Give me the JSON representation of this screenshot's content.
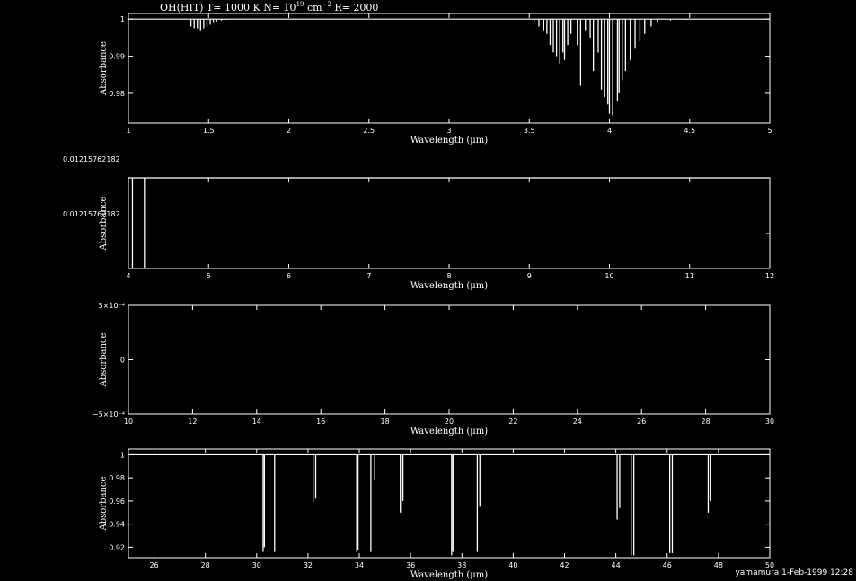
{
  "title": "OH(HIT) T= 1000 K N= 10^19 cm^-2 R= 2000",
  "footer": "yamamura 1-Feb-1999 12:28",
  "colors": {
    "background": "#000000",
    "foreground": "#ffffff"
  },
  "chart_data": [
    {
      "type": "line",
      "xlabel": "Wavelength (μm)",
      "ylabel": "Absorbance",
      "xlim": [
        1,
        5
      ],
      "ylim": [
        0.972,
        1.0015
      ],
      "baseline": 1.0,
      "xticks": [
        1,
        1.5,
        2,
        2.5,
        3,
        3.5,
        4,
        4.5,
        5
      ],
      "xtick_labels": [
        "1",
        "1.5",
        "2",
        "2.5",
        "3",
        "3.5",
        "4",
        "4.5",
        "5"
      ],
      "yticks": [
        1.0,
        0.99,
        0.98
      ],
      "ytick_labels": [
        "1",
        "0.99",
        "0.98"
      ],
      "lines": [
        {
          "x": 1.39,
          "y": 0.998
        },
        {
          "x": 1.41,
          "y": 0.9975
        },
        {
          "x": 1.43,
          "y": 0.9975
        },
        {
          "x": 1.45,
          "y": 0.997
        },
        {
          "x": 1.47,
          "y": 0.9975
        },
        {
          "x": 1.49,
          "y": 0.998
        },
        {
          "x": 1.51,
          "y": 0.9985
        },
        {
          "x": 1.53,
          "y": 0.999
        },
        {
          "x": 1.55,
          "y": 0.9993
        },
        {
          "x": 1.58,
          "y": 0.9996
        },
        {
          "x": 1.61,
          "y": 0.9998
        },
        {
          "x": 1.65,
          "y": 0.9999
        },
        {
          "x": 3.53,
          "y": 0.999
        },
        {
          "x": 3.56,
          "y": 0.998
        },
        {
          "x": 3.59,
          "y": 0.997
        },
        {
          "x": 3.61,
          "y": 0.996
        },
        {
          "x": 3.63,
          "y": 0.993
        },
        {
          "x": 3.65,
          "y": 0.991
        },
        {
          "x": 3.67,
          "y": 0.99
        },
        {
          "x": 3.69,
          "y": 0.988
        },
        {
          "x": 3.71,
          "y": 0.991
        },
        {
          "x": 3.72,
          "y": 0.989
        },
        {
          "x": 3.74,
          "y": 0.993
        },
        {
          "x": 3.76,
          "y": 0.996
        },
        {
          "x": 3.8,
          "y": 0.993
        },
        {
          "x": 3.82,
          "y": 0.982
        },
        {
          "x": 3.85,
          "y": 0.997
        },
        {
          "x": 3.88,
          "y": 0.995
        },
        {
          "x": 3.9,
          "y": 0.986
        },
        {
          "x": 3.93,
          "y": 0.991
        },
        {
          "x": 3.95,
          "y": 0.981
        },
        {
          "x": 3.97,
          "y": 0.979
        },
        {
          "x": 3.99,
          "y": 0.977
        },
        {
          "x": 4.0,
          "y": 0.9745
        },
        {
          "x": 4.02,
          "y": 0.974
        },
        {
          "x": 4.05,
          "y": 0.978
        },
        {
          "x": 4.06,
          "y": 0.98
        },
        {
          "x": 4.08,
          "y": 0.9835
        },
        {
          "x": 4.1,
          "y": 0.986
        },
        {
          "x": 4.13,
          "y": 0.989
        },
        {
          "x": 4.16,
          "y": 0.992
        },
        {
          "x": 4.19,
          "y": 0.994
        },
        {
          "x": 4.22,
          "y": 0.996
        },
        {
          "x": 4.26,
          "y": 0.998
        },
        {
          "x": 4.3,
          "y": 0.999
        },
        {
          "x": 4.38,
          "y": 0.9996
        },
        {
          "x": 4.48,
          "y": 0.9998
        }
      ]
    },
    {
      "type": "line",
      "xlabel": "Wavelength (μm)",
      "ylabel": "Absorbance",
      "xlim": [
        4,
        12
      ],
      "ylim": [
        0,
        1
      ],
      "baseline": 1.0,
      "xticks": [
        4,
        5,
        6,
        7,
        8,
        9,
        10,
        11,
        12
      ],
      "xtick_labels": [
        "4",
        "5",
        "6",
        "7",
        "8",
        "9",
        "10",
        "11",
        "12"
      ],
      "ytick_labels": [
        "0.01215762182",
        "0.01215762182"
      ],
      "lines": [
        {
          "x": 4.05,
          "y": 0.0
        },
        {
          "x": 4.2,
          "y": 0.0
        }
      ]
    },
    {
      "type": "line",
      "xlabel": "Wavelength (μm)",
      "ylabel": "Absorbance",
      "xlim": [
        10,
        30
      ],
      "ylim": [
        -0.0005,
        0.0005
      ],
      "xticks": [
        10,
        12,
        14,
        16,
        18,
        20,
        22,
        24,
        26,
        28,
        30
      ],
      "xtick_labels": [
        "10",
        "12",
        "14",
        "16",
        "18",
        "20",
        "22",
        "24",
        "26",
        "28",
        "30"
      ],
      "yticks": [
        0.0005,
        0,
        -0.0005
      ],
      "ytick_labels": [
        "5×10⁻⁴",
        "0",
        "−5×10⁻⁴"
      ],
      "lines": []
    },
    {
      "type": "line",
      "xlabel": "Wavelength (μm)",
      "ylabel": "Absorbance",
      "xlim": [
        25,
        50
      ],
      "ylim": [
        0.911,
        1.005
      ],
      "baseline": 1.0,
      "xticks": [
        26,
        28,
        30,
        32,
        34,
        36,
        38,
        40,
        42,
        44,
        46,
        48,
        50
      ],
      "xtick_labels": [
        "26",
        "28",
        "30",
        "32",
        "34",
        "36",
        "38",
        "40",
        "42",
        "44",
        "46",
        "48",
        "50"
      ],
      "yticks": [
        1.0,
        0.98,
        0.96,
        0.94,
        0.92
      ],
      "ytick_labels": [
        "1",
        "0.98",
        "0.96",
        "0.94",
        "0.92"
      ],
      "lines": [
        {
          "x": 30.25,
          "y": 0.916
        },
        {
          "x": 30.3,
          "y": 0.92
        },
        {
          "x": 30.7,
          "y": 0.916
        },
        {
          "x": 32.2,
          "y": 0.959
        },
        {
          "x": 32.3,
          "y": 0.962
        },
        {
          "x": 33.9,
          "y": 0.916
        },
        {
          "x": 33.95,
          "y": 0.918
        },
        {
          "x": 34.45,
          "y": 0.916
        },
        {
          "x": 34.6,
          "y": 0.978
        },
        {
          "x": 35.6,
          "y": 0.95
        },
        {
          "x": 35.7,
          "y": 0.96
        },
        {
          "x": 37.6,
          "y": 0.913
        },
        {
          "x": 37.65,
          "y": 0.916
        },
        {
          "x": 38.6,
          "y": 0.916
        },
        {
          "x": 38.7,
          "y": 0.955
        },
        {
          "x": 44.05,
          "y": 0.944
        },
        {
          "x": 44.15,
          "y": 0.954
        },
        {
          "x": 44.6,
          "y": 0.913
        },
        {
          "x": 44.7,
          "y": 0.913
        },
        {
          "x": 46.1,
          "y": 0.915
        },
        {
          "x": 46.2,
          "y": 0.915
        },
        {
          "x": 47.6,
          "y": 0.95
        },
        {
          "x": 47.7,
          "y": 0.96
        }
      ]
    }
  ]
}
